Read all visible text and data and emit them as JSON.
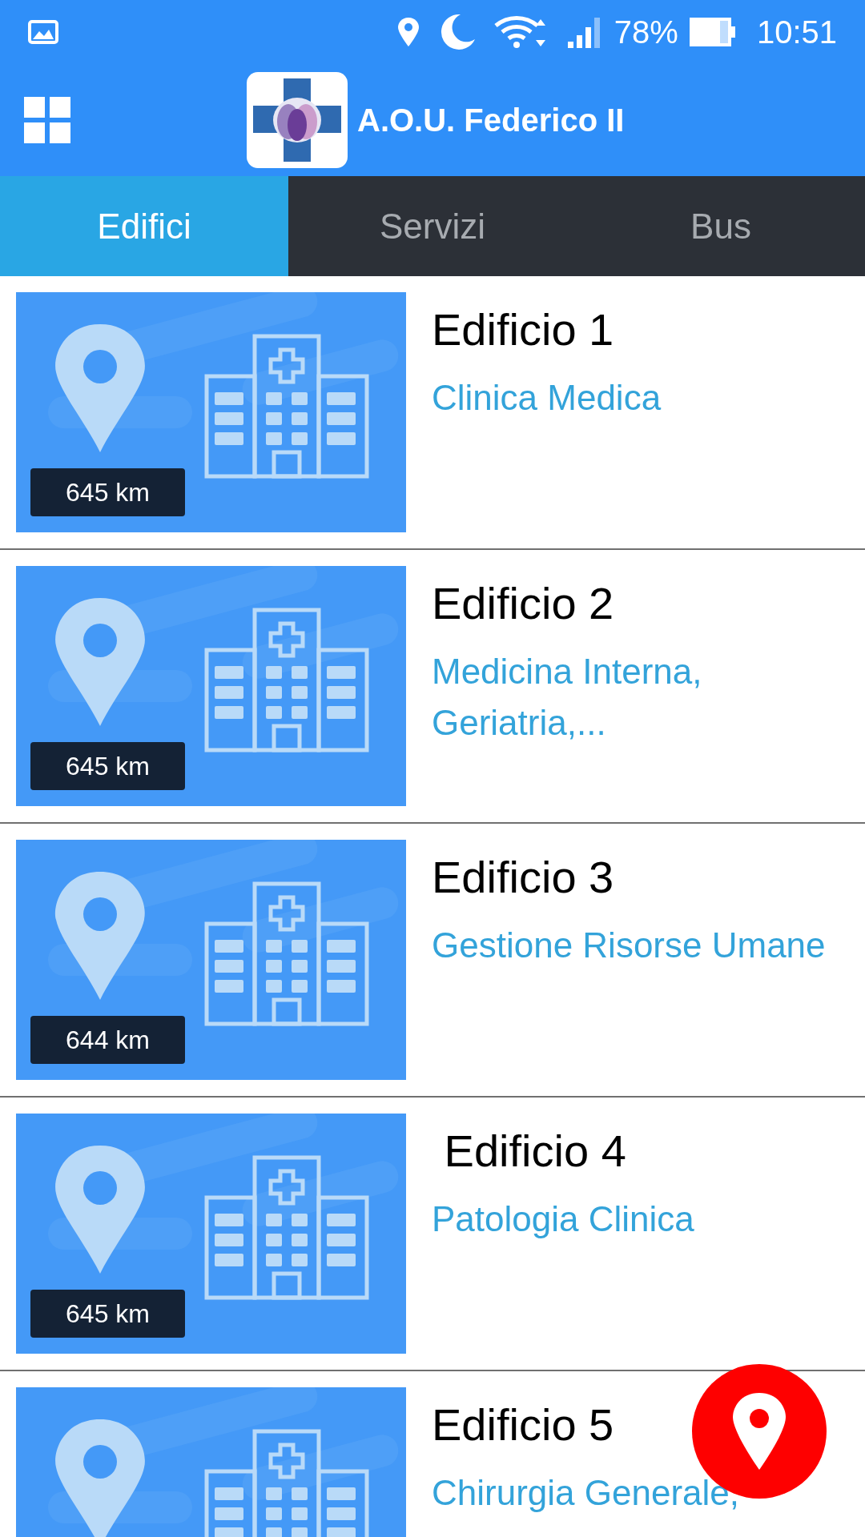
{
  "status_bar": {
    "battery": "78%",
    "time": "10:51"
  },
  "header": {
    "title": "A.O.U. Federico II"
  },
  "tabs": [
    {
      "label": "Edifici",
      "selected": true
    },
    {
      "label": "Servizi",
      "selected": false
    },
    {
      "label": "Bus",
      "selected": false
    }
  ],
  "buildings": [
    {
      "distance": "645 km",
      "name": "Edificio 1",
      "departments": "Clinica Medica"
    },
    {
      "distance": "645 km",
      "name": "Edificio 2",
      "departments": "Medicina Interna, Geriatria,..."
    },
    {
      "distance": "644 km",
      "name": "Edificio 3",
      "departments": "Gestione Risorse Umane"
    },
    {
      "distance": "645 km",
      "name": " Edificio 4",
      "departments": "Patologia Clinica"
    },
    {
      "name": "Edificio 5",
      "departments": "Chirurgia Generale,"
    }
  ]
}
